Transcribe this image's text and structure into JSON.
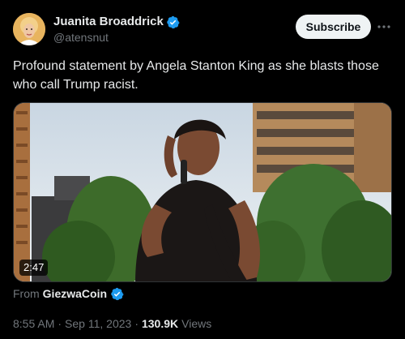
{
  "author": {
    "display_name": "Juanita Broaddrick",
    "handle": "@atensnut",
    "verified_icon": "verified-badge-icon"
  },
  "actions": {
    "subscribe_label": "Subscribe",
    "more_icon": "more-icon"
  },
  "tweet": {
    "text": "Profound statement by Angela Stanton King as she blasts those who call Trump racist."
  },
  "media": {
    "type": "video",
    "duration": "2:47"
  },
  "source": {
    "prefix": "From",
    "name": "GiezwaCoin",
    "verified_icon": "verified-badge-icon"
  },
  "meta": {
    "time": "8:55 AM",
    "separator": "·",
    "date": "Sep 11, 2023",
    "views_count": "130.9K",
    "views_label": "Views"
  },
  "colors": {
    "background": "#000000",
    "text_primary": "#e7e9ea",
    "text_secondary": "#71767b",
    "verified_blue": "#1d9bf0",
    "subscribe_bg": "#eff3f4"
  }
}
